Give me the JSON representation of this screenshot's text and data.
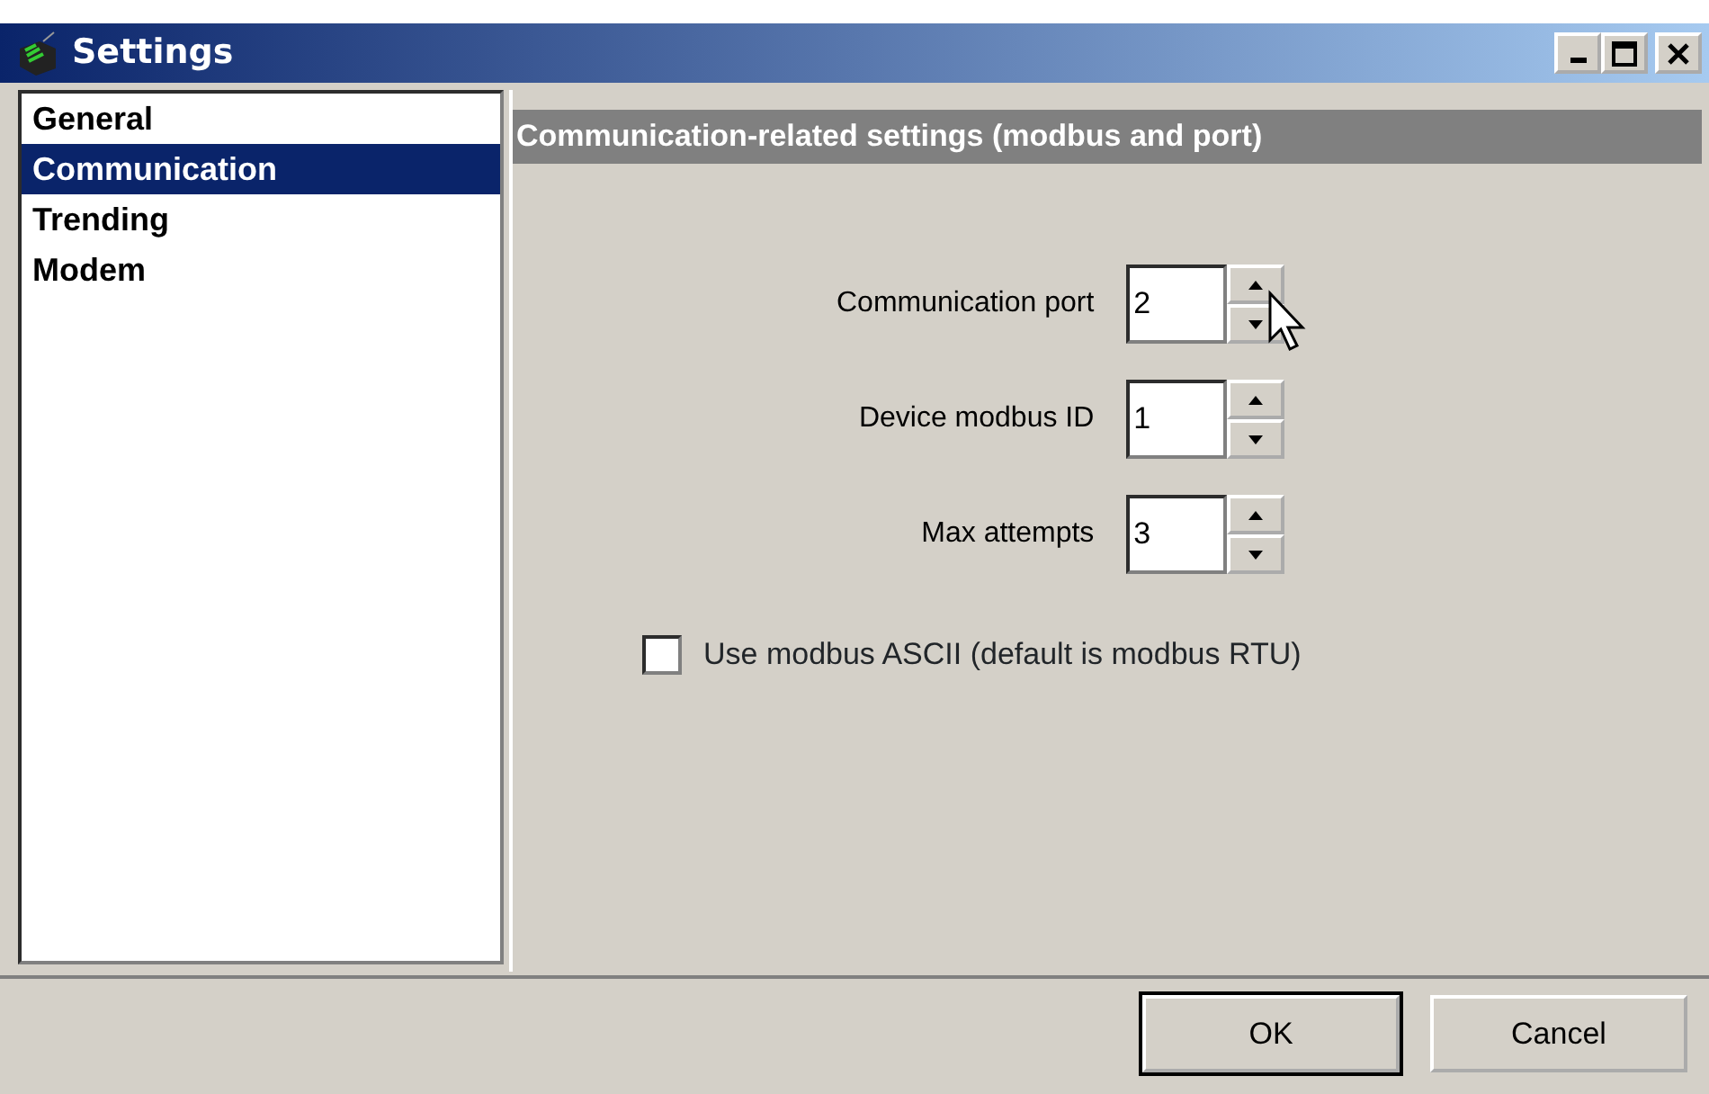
{
  "window": {
    "title": "Settings"
  },
  "sidebar": {
    "items": [
      {
        "label": "General",
        "selected": false
      },
      {
        "label": "Communication",
        "selected": true
      },
      {
        "label": "Trending",
        "selected": false
      },
      {
        "label": "Modem",
        "selected": false
      }
    ]
  },
  "panel": {
    "heading": "Communication-related settings (modbus and port)",
    "spinners": [
      {
        "label": "Communication port",
        "value": "2"
      },
      {
        "label": "Device modbus ID",
        "value": "1"
      },
      {
        "label": "Max attempts",
        "value": "3"
      }
    ],
    "checkbox": {
      "label": "Use modbus ASCII (default is modbus RTU)",
      "checked": false
    }
  },
  "buttons": [
    {
      "label": "OK",
      "default": true
    },
    {
      "label": "Cancel",
      "default": false
    }
  ]
}
